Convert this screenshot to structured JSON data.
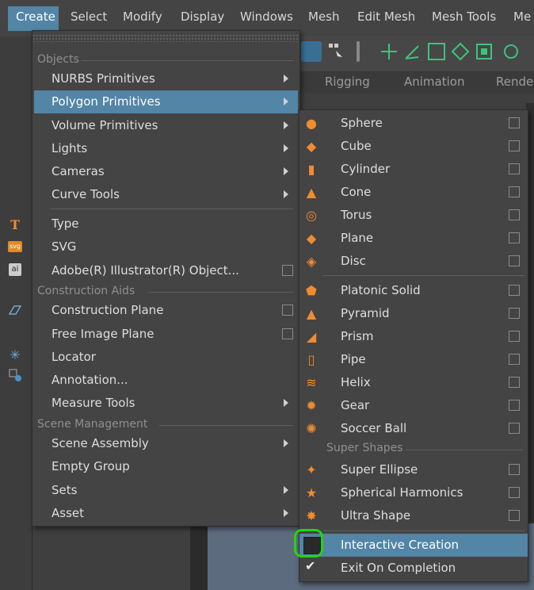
{
  "menubar": {
    "items": [
      "Create",
      "Select",
      "Modify",
      "Display",
      "Windows",
      "Mesh",
      "Edit Mesh",
      "Mesh Tools",
      "Me"
    ]
  },
  "shelf": {
    "tabs": [
      "Rigging",
      "Animation",
      "Rende"
    ]
  },
  "left_icons": [
    "type-icon",
    "svg-icon",
    "ai-icon",
    "construction-plane-icon",
    "locator-icon",
    "annotation-icon"
  ],
  "left_icon_text": {
    "type": "T",
    "svg": "svg",
    "ai": "ai",
    "locator": "✳"
  },
  "create_menu": {
    "sections": {
      "objects": "Objects",
      "construction_aids": "Construction Aids",
      "scene_management": "Scene Management"
    },
    "items": [
      {
        "label": "NURBS Primitives",
        "submenu": true
      },
      {
        "label": "Polygon Primitives",
        "submenu": true,
        "highlighted": true
      },
      {
        "label": "Volume Primitives",
        "submenu": true
      },
      {
        "label": "Lights",
        "submenu": true
      },
      {
        "label": "Cameras",
        "submenu": true
      },
      {
        "label": "Curve Tools",
        "submenu": true
      },
      {
        "label": "Type"
      },
      {
        "label": "SVG"
      },
      {
        "label": "Adobe(R) Illustrator(R) Object...",
        "option": true
      },
      {
        "label": "Construction Plane",
        "option": true
      },
      {
        "label": "Free Image Plane",
        "option": true
      },
      {
        "label": "Locator"
      },
      {
        "label": "Annotation..."
      },
      {
        "label": "Measure Tools",
        "submenu": true
      },
      {
        "label": "Scene Assembly",
        "submenu": true
      },
      {
        "label": "Empty Group"
      },
      {
        "label": "Sets",
        "submenu": true
      },
      {
        "label": "Asset",
        "submenu": true
      }
    ]
  },
  "polygon_submenu": {
    "section_super_shapes": "Super Shapes",
    "items": [
      {
        "label": "Sphere",
        "icon": "sphere-icon"
      },
      {
        "label": "Cube",
        "icon": "cube-icon"
      },
      {
        "label": "Cylinder",
        "icon": "cylinder-icon"
      },
      {
        "label": "Cone",
        "icon": "cone-icon"
      },
      {
        "label": "Torus",
        "icon": "torus-icon"
      },
      {
        "label": "Plane",
        "icon": "plane-icon"
      },
      {
        "label": "Disc",
        "icon": "disc-icon"
      },
      {
        "label": "Platonic Solid",
        "icon": "platonic-solid-icon"
      },
      {
        "label": "Pyramid",
        "icon": "pyramid-icon"
      },
      {
        "label": "Prism",
        "icon": "prism-icon"
      },
      {
        "label": "Pipe",
        "icon": "pipe-icon"
      },
      {
        "label": "Helix",
        "icon": "helix-icon"
      },
      {
        "label": "Gear",
        "icon": "gear-icon"
      },
      {
        "label": "Soccer Ball",
        "icon": "soccer-ball-icon"
      },
      {
        "label": "Super Ellipse",
        "icon": "super-ellipse-icon"
      },
      {
        "label": "Spherical Harmonics",
        "icon": "spherical-harmonics-icon"
      },
      {
        "label": "Ultra Shape",
        "icon": "ultra-shape-icon"
      }
    ],
    "interactive_creation": {
      "label": "Interactive Creation",
      "checked": false,
      "highlighted": true
    },
    "exit_on_completion": {
      "label": "Exit On Completion",
      "checked": true
    }
  },
  "colors": {
    "highlight": "#5285a6",
    "menu_bg": "#444444",
    "icon_orange": "#f08c30",
    "annotation_ring": "#22d60f"
  }
}
